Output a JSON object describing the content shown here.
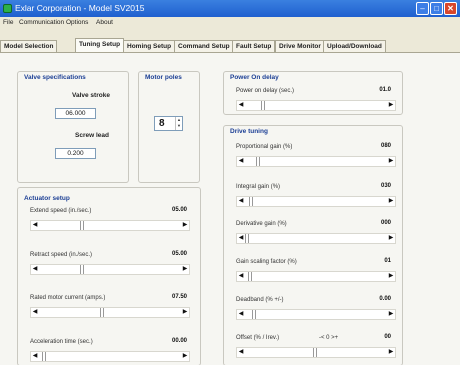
{
  "window": {
    "title": "Exlar Corporation - Model SV2015"
  },
  "menu": [
    "File",
    "Communication",
    "Options",
    "About"
  ],
  "tabs": [
    "Model Selection",
    "Tuning Setup",
    "Homing Setup",
    "Command Setup",
    "Fault Setup",
    "Drive Monitor",
    "Upload/Download"
  ],
  "active_tab": "Tuning Setup",
  "valve_specs": {
    "title": "Valve specifications",
    "stroke_label": "Valve stroke",
    "stroke_value": "06.000",
    "lead_label": "Screw lead",
    "lead_value": "0.200"
  },
  "motor_poles": {
    "title": "Motor poles",
    "value": "8"
  },
  "actuator_setup": {
    "title": "Actuator setup",
    "rows": [
      {
        "label": "Extend speed (in./sec.)",
        "value": "05.00",
        "position": 0.3
      },
      {
        "label": "Retract speed (in./sec.)",
        "value": "05.00",
        "position": 0.3
      },
      {
        "label": "Rated motor current (amps.)",
        "value": "07.50",
        "position": 0.45
      },
      {
        "label": "Acceleration time (sec.)",
        "value": "00.00",
        "position": 0.02
      }
    ]
  },
  "power_on_delay": {
    "title": "Power On delay",
    "label": "Power on delay (sec.)",
    "value": "01.0",
    "position": 0.12
  },
  "drive_tuning": {
    "title": "Drive tuning",
    "rows": [
      {
        "label": "Proportional gain (%)",
        "value": "080",
        "position": 0.08
      },
      {
        "label": "Integral gain (%)",
        "value": "030",
        "position": 0.03
      },
      {
        "label": "Derivative gain (%)",
        "value": "000",
        "position": 0.0
      },
      {
        "label": "Gain scaling factor (%)",
        "value": "01",
        "position": 0.02
      },
      {
        "label": "Deadband (% +/-)",
        "value": "0.00",
        "position": 0.05
      },
      {
        "label": "Offset (% / Irev.)",
        "extra": "-< 0 >+",
        "value": "00",
        "position": 0.5
      }
    ]
  }
}
